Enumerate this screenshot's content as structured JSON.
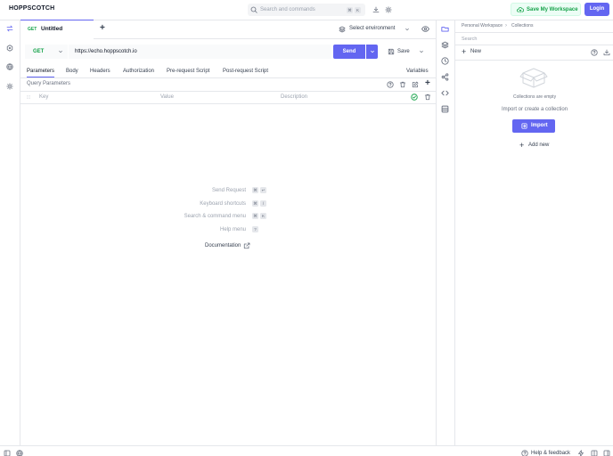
{
  "app": {
    "title": "HOPPSCOTCH"
  },
  "search": {
    "label": "Search and commands",
    "keys": [
      "⌘",
      "K"
    ]
  },
  "header": {
    "save_workspace_label": "Save My Workspace",
    "login_label": "Login"
  },
  "tabs": [
    {
      "method": "GET",
      "title": "Untitled"
    }
  ],
  "environment": {
    "selected": "Select environment"
  },
  "request": {
    "method": "GET",
    "url": "https://echo.hoppscotch.io",
    "send_label": "Send",
    "save_label": "Save"
  },
  "request_tabs": [
    "Parameters",
    "Body",
    "Headers",
    "Authorization",
    "Pre-request Script",
    "Post-request Script"
  ],
  "variables_label": "Variables",
  "params": {
    "title": "Query Parameters",
    "key_placeholder": "Key",
    "value_placeholder": "Value",
    "description_placeholder": "Description"
  },
  "shortcuts": [
    {
      "label": "Send Request",
      "keys": [
        "⌘",
        "↵"
      ]
    },
    {
      "label": "Keyboard shortcuts",
      "keys": [
        "⌘",
        "/"
      ]
    },
    {
      "label": "Search & command menu",
      "keys": [
        "⌘",
        "K"
      ]
    },
    {
      "label": "Help menu",
      "keys": [
        "?"
      ]
    }
  ],
  "documentation_label": "Documentation",
  "collections": {
    "breadcrumb_workspace": "Personal Workspace",
    "breadcrumb_section": "Collections",
    "search_placeholder": "Search",
    "new_label": "New",
    "empty_title": "Collections are empty",
    "empty_hint": "Import or create a collection",
    "import_label": "Import",
    "add_new_label": "Add new"
  },
  "footer": {
    "help_label": "Help & feedback"
  },
  "colors": {
    "accent": "#6366f1",
    "method_green": "#16a34a",
    "workspace_btn_bg": "#ecfdf5"
  }
}
